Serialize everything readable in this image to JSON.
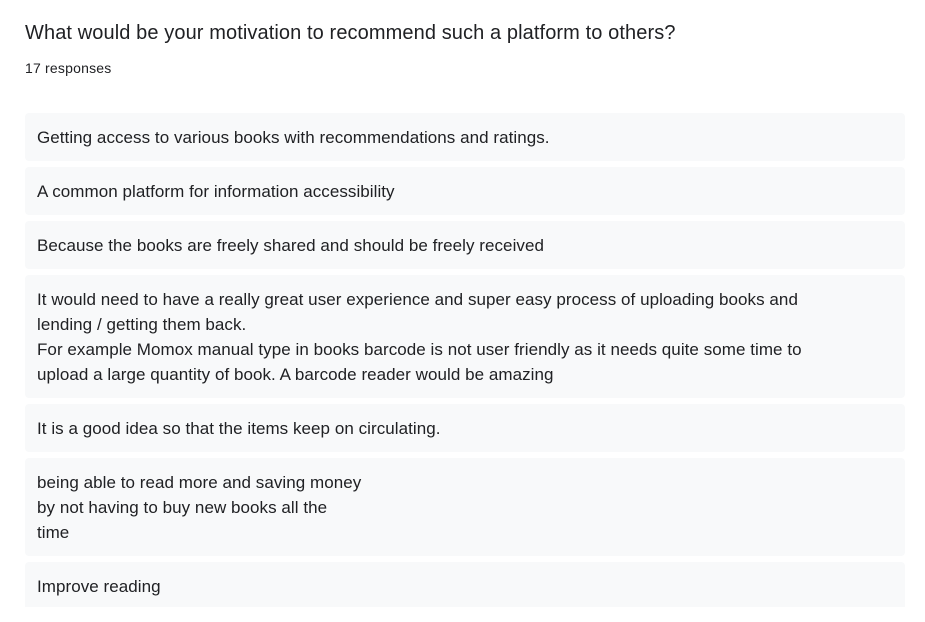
{
  "question": {
    "title": "What would be your motivation to recommend such a platform to others?",
    "response_count": "17 responses"
  },
  "responses": [
    "Getting access to various books with recommendations and ratings.",
    "A common platform for information accessibility",
    "Because the books are freely shared and should be freely received",
    "It would need to have a really great user experience and super easy process of uploading books and\nlending / getting them back.\nFor example Momox manual type in books barcode is not user friendly as it needs quite some time to\nupload a large quantity of book. A barcode reader would be amazing",
    "It is a good idea so that the items keep on circulating.",
    "being able to read more and saving money\nby not having to buy new books all the\ntime",
    "Improve reading"
  ]
}
